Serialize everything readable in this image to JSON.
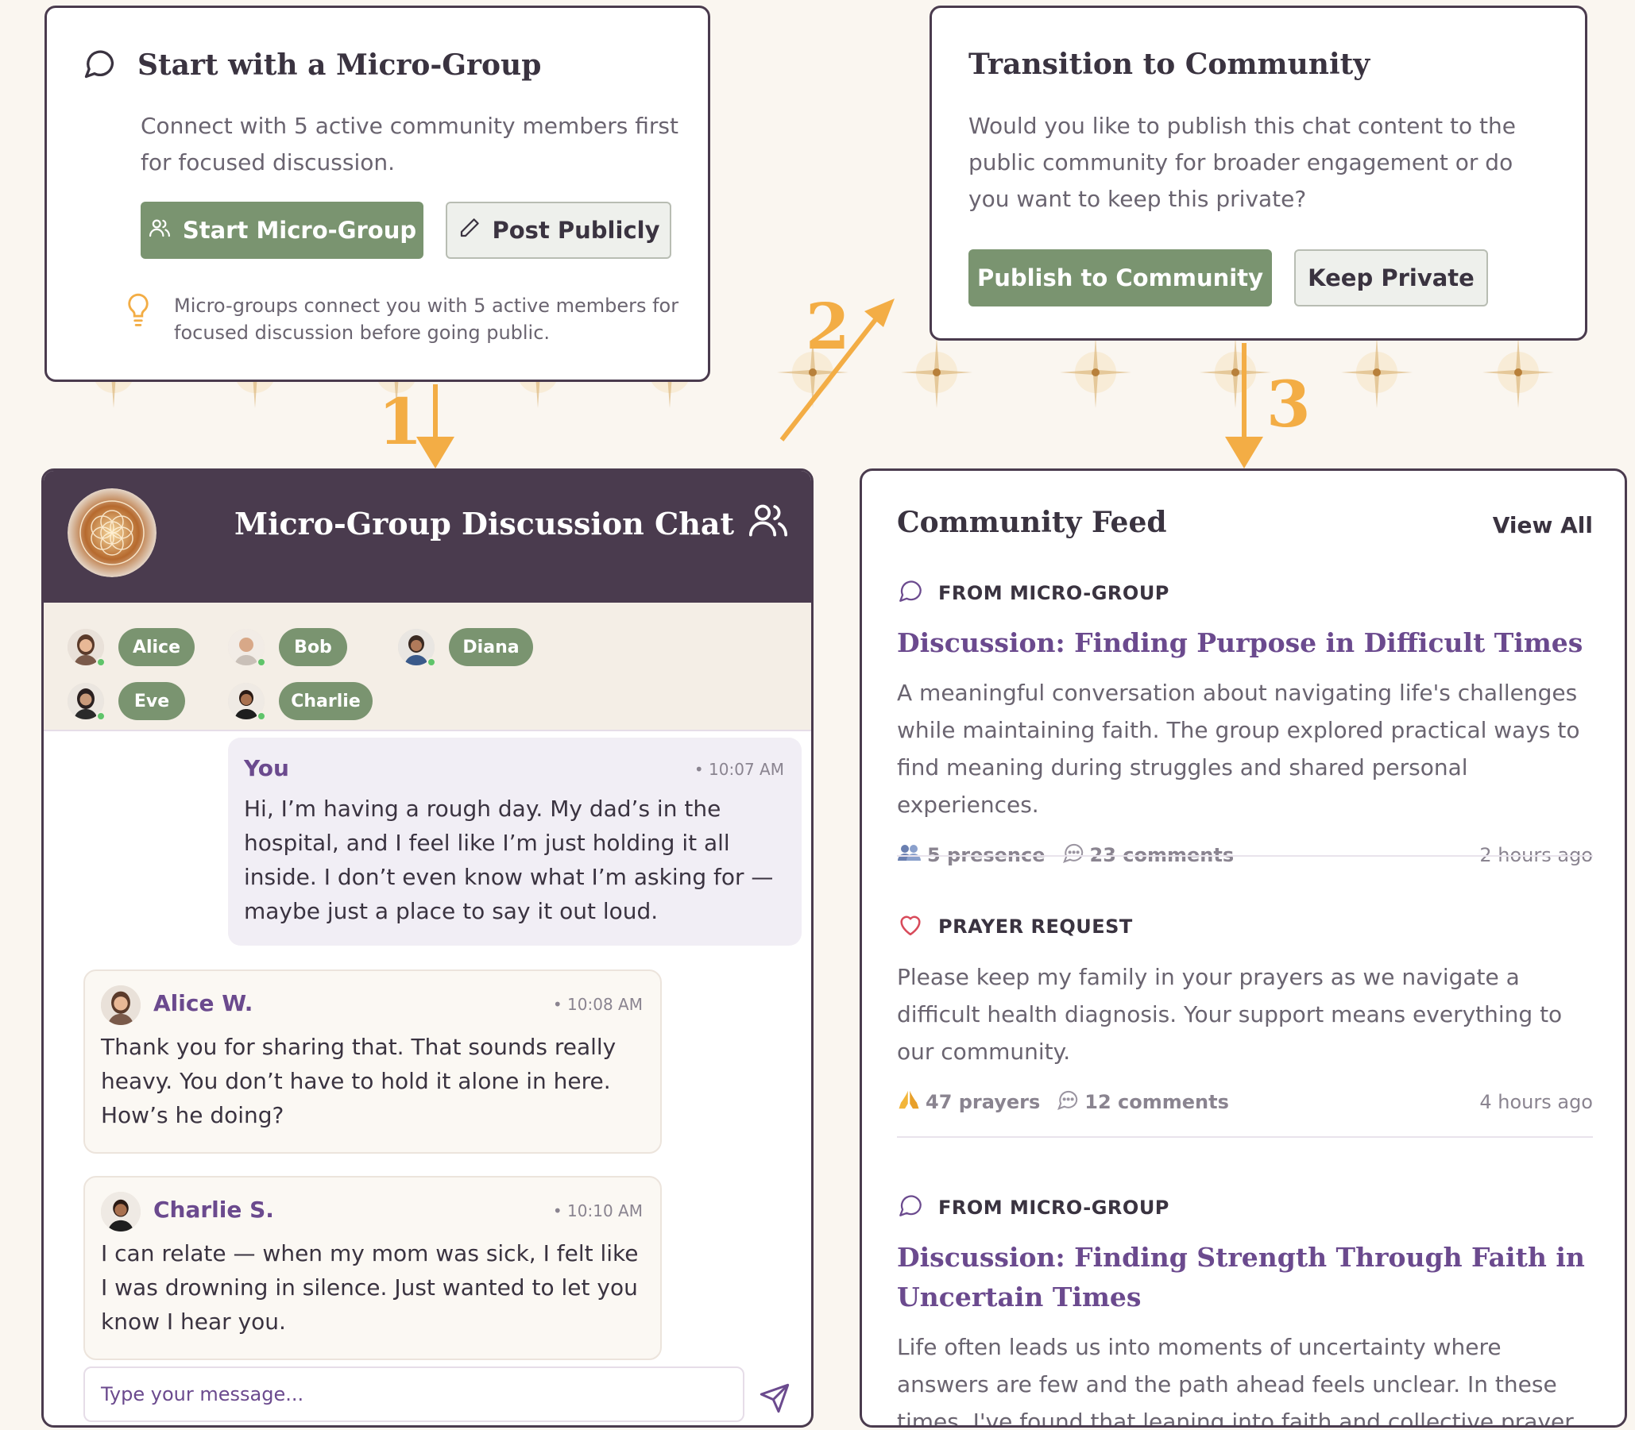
{
  "micro_group_card": {
    "title": "Start with a Micro-Group",
    "description": "Connect with 5 active community members first for focused discussion.",
    "start_button": "Start Micro-Group",
    "post_button": "Post Publicly",
    "tip": "Micro-groups connect you with 5 active members for focused discussion before going public."
  },
  "transition_card": {
    "title": "Transition to Community",
    "description": "Would you like to publish this chat content to the public community for broader engagement or do you want to keep this private?",
    "publish_button": "Publish to Community",
    "keep_button": "Keep Private"
  },
  "steps": [
    "1",
    "2",
    "3"
  ],
  "chat": {
    "title": "Micro-Group Discussion Chat",
    "members": [
      "Alice",
      "Bob",
      "Diana",
      "Eve",
      "Charlie"
    ],
    "messages": [
      {
        "author": "You",
        "time": "• 10:07 AM",
        "text": "Hi, I’m having a rough day. My dad’s in the hospital, and I feel like I’m just holding it all inside. I don’t even know what I’m asking for — maybe just a place to say it out loud."
      },
      {
        "author": "Alice W.",
        "time": "• 10:08 AM",
        "text": "Thank you for sharing that. That sounds really heavy. You don’t have to hold it alone in here. How’s he doing?"
      },
      {
        "author": "Charlie S.",
        "time": "• 10:10 AM",
        "text": "I can relate — when my mom was sick, I felt like I was drowning in silence. Just wanted to let you know I hear you."
      }
    ],
    "input_placeholder": "Type your message..."
  },
  "feed": {
    "title": "Community Feed",
    "view_all": "View All",
    "posts": [
      {
        "kind": "FROM MICRO-GROUP",
        "title": "Discussion: Finding Purpose in Difficult Times",
        "body": "A meaningful conversation about navigating life's challenges while maintaining faith. The group explored practical ways to find meaning during struggles and shared personal experiences.",
        "stat1": "5 presence",
        "stat2": "23 comments",
        "ago": "2 hours ago"
      },
      {
        "kind": "PRAYER REQUEST",
        "title": "",
        "body": "Please keep my family in your prayers as we navigate a difficult health diagnosis. Your support means everything to our community.",
        "stat1": "47 prayers",
        "stat2": "12 comments",
        "ago": "4 hours ago"
      },
      {
        "kind": "FROM MICRO-GROUP",
        "title": "Discussion: Finding Strength Through Faith in Uncertain Times",
        "body": "Life often leads us into moments of uncertainty where answers are few and the path ahead feels unclear. In these times, I've found that leaning into faith and collective prayer brings",
        "stat1": "",
        "stat2": "",
        "ago": ""
      }
    ]
  },
  "colors": {
    "accent_green": "#7a9470",
    "header_purple": "#4a3b4e",
    "link_purple": "#6b4a8e",
    "arrow_orange": "#f3ad45",
    "background": "#faf6f0"
  },
  "icons": [
    "chat-bubble-icon",
    "users-icon",
    "pencil-icon",
    "lightbulb-icon",
    "heart-icon",
    "send-icon",
    "prayer-hands-icon",
    "presence-icon",
    "comment-icon"
  ]
}
